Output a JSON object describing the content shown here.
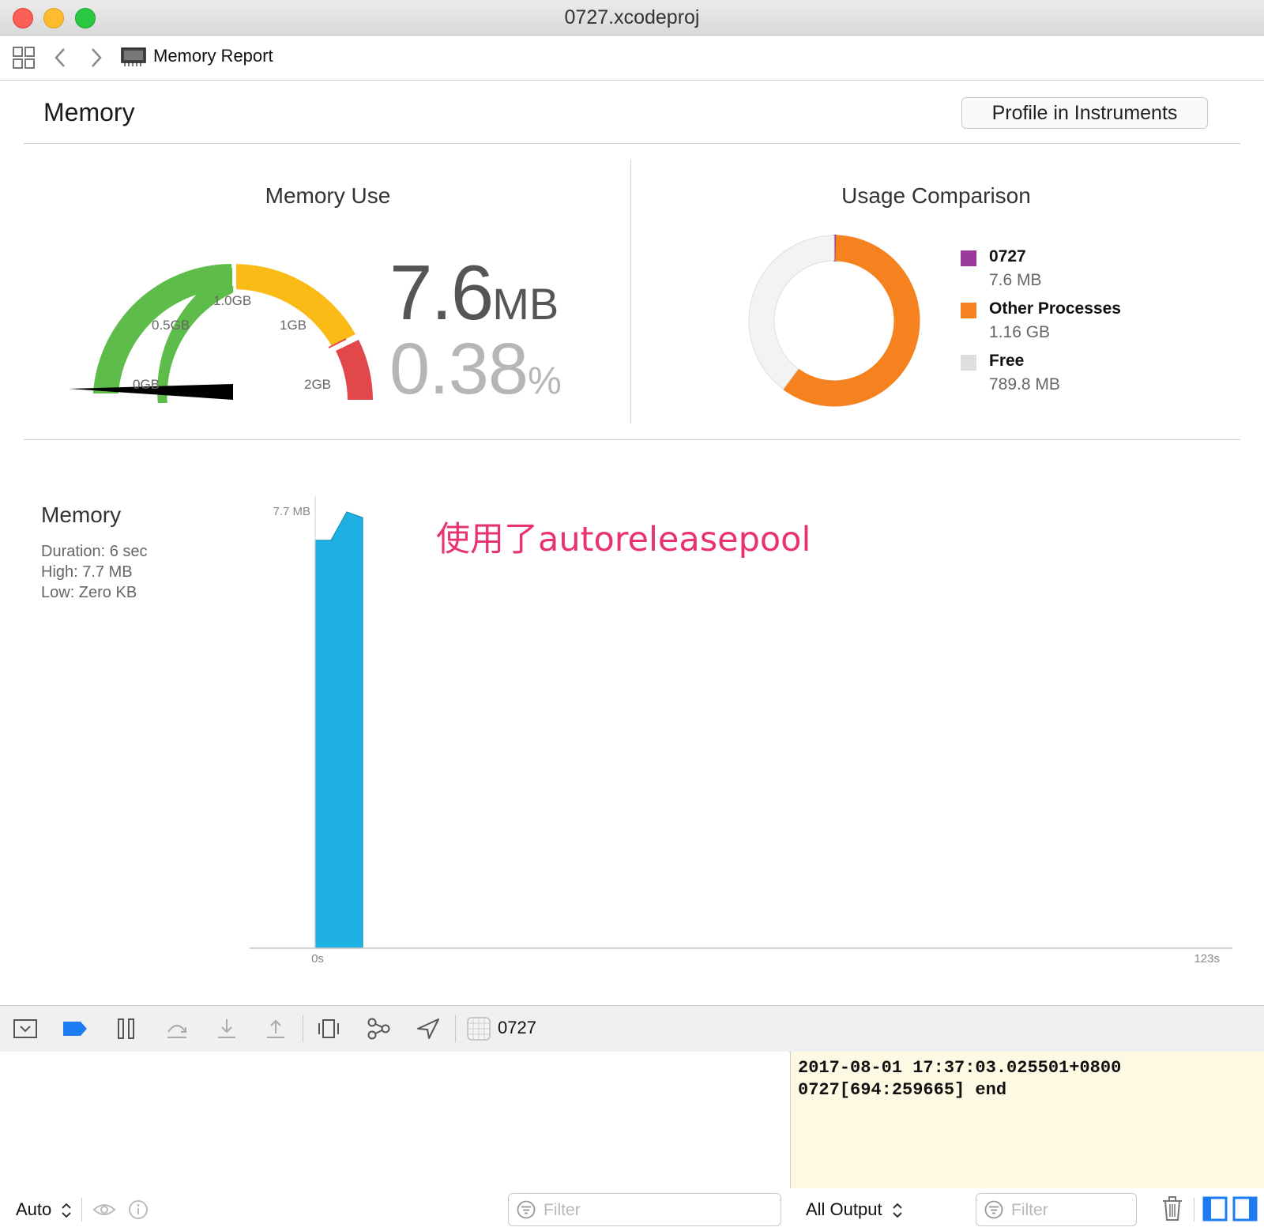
{
  "window": {
    "title": "0727.xcodeproj"
  },
  "nav": {
    "breadcrumb": "Memory Report"
  },
  "header": {
    "title": "Memory",
    "profile_button": "Profile in Instruments"
  },
  "memory_use": {
    "title": "Memory Use",
    "value": "7.6",
    "unit": "MB",
    "percent": "0.38",
    "percent_sign": "%",
    "gauge_labels": [
      "0GB",
      "0.5GB",
      "1.0GB",
      "1GB",
      "2GB"
    ],
    "colors": {
      "green": "#5ebd4a",
      "yellow": "#fbbb16",
      "red": "#e2474b"
    }
  },
  "usage_comparison": {
    "title": "Usage Comparison",
    "legend": [
      {
        "name": "0727",
        "value": "7.6 MB",
        "color": "#993a9a"
      },
      {
        "name": "Other Processes",
        "value": "1.16 GB",
        "color": "#f5821f"
      },
      {
        "name": "Free",
        "value": "789.8 MB",
        "color": "#dedede"
      }
    ]
  },
  "graph": {
    "title": "Memory",
    "duration": "Duration: 6 sec",
    "high": "High: 7.7 MB",
    "low": "Low: Zero KB",
    "annotation": "使用了autoreleasepool",
    "y_max_label": "7.7 MB",
    "x_start_label": "0s",
    "x_end_label": "123s",
    "bar_color": "#1eb0e3"
  },
  "debug": {
    "process": "0727"
  },
  "bottom": {
    "auto_select": "Auto",
    "filter_placeholder": "Filter",
    "output_select": "All Output",
    "filter_placeholder_2": "Filter"
  },
  "console": {
    "log": "2017-08-01 17:37:03.025501+0800\n0727[694:259665] end"
  },
  "chart_data": [
    {
      "type": "pie",
      "title": "Usage Comparison",
      "labels": [
        "0727",
        "Other Processes",
        "Free"
      ],
      "values": [
        7.6,
        1187.84,
        789.8
      ],
      "unit": "MB"
    },
    {
      "type": "area",
      "title": "Memory",
      "x": [
        0,
        2,
        4,
        6
      ],
      "y": [
        7.2,
        7.2,
        7.7,
        7.6
      ],
      "xlim": [
        0,
        123
      ],
      "ylim": [
        0,
        7.7
      ],
      "xlabel": "",
      "ylabel": ""
    }
  ]
}
